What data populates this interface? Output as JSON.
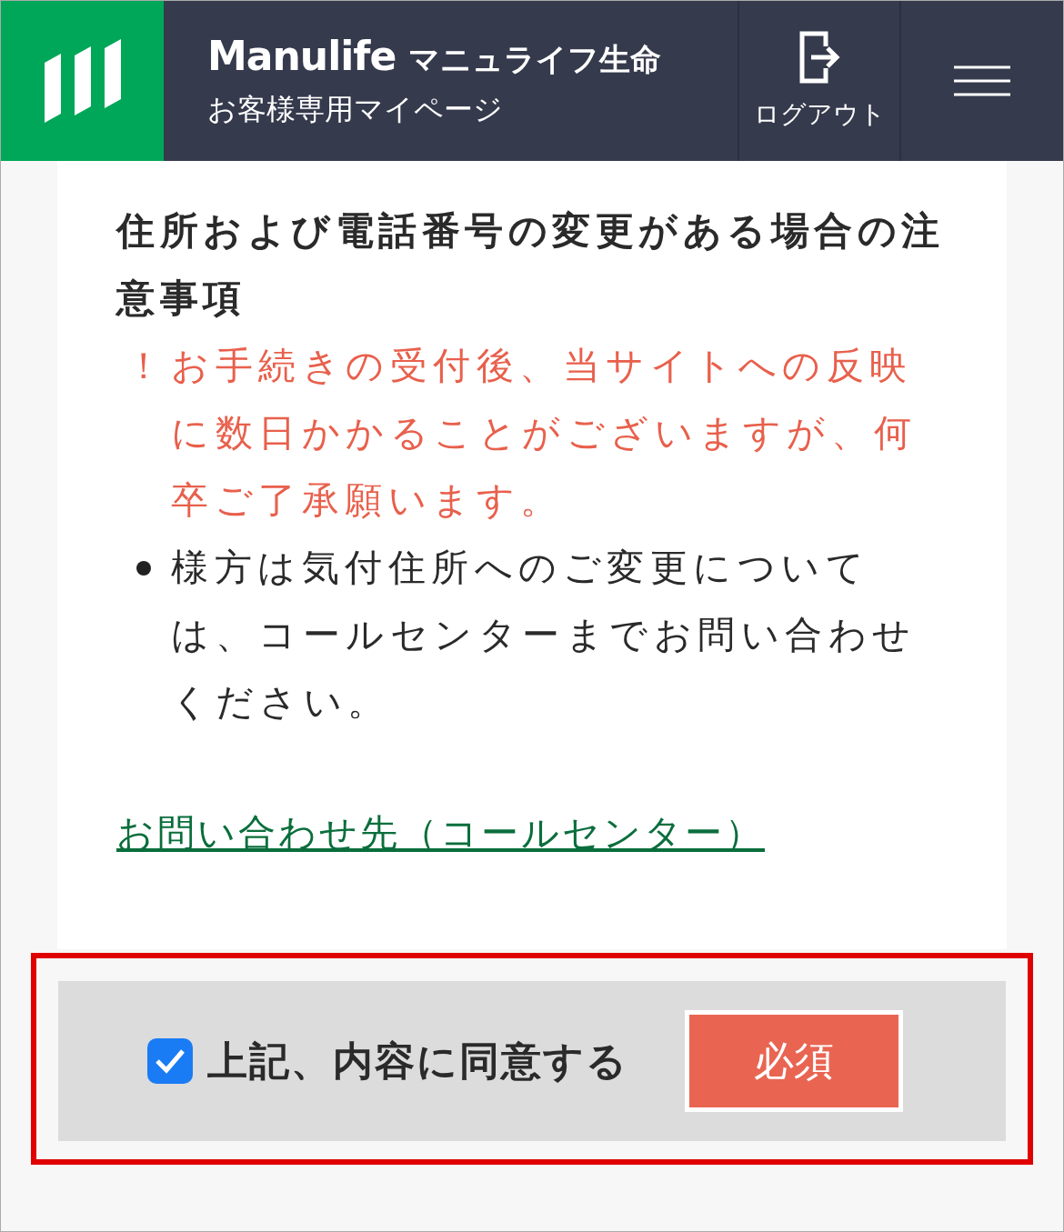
{
  "header": {
    "brand": "Manulife",
    "brand_sub": "マニュライフ生命",
    "subtitle": "お客様専用マイページ",
    "logout": "ログアウト"
  },
  "notice": {
    "title": "住所および電話番号の変更がある場合の注意事項",
    "items": [
      {
        "kind": "warning",
        "marker": "！",
        "text": "お手続きの受付後、当サイトへの反映に数日かかることがございますが、何卒ご了承願います。"
      },
      {
        "kind": "bullet",
        "text": "様方は気付住所へのご変更については、コールセンターまでお問い合わせください。"
      }
    ],
    "link": "お問い合わせ先（コールセンター）"
  },
  "agreement": {
    "label": "上記、内容に同意する",
    "checked": true,
    "badge": "必須"
  }
}
